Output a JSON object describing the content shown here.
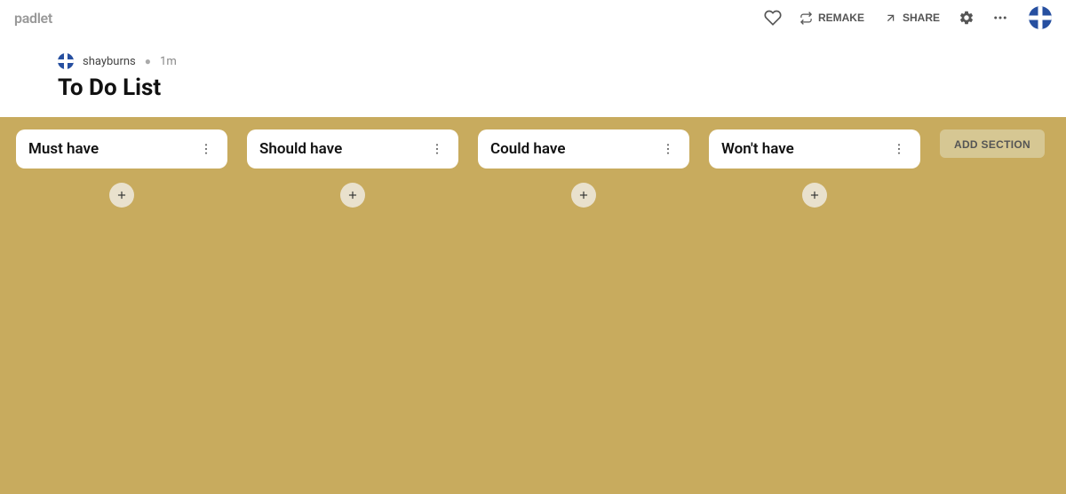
{
  "logo": "padlet",
  "header": {
    "remake_label": "REMAKE",
    "share_label": "SHARE"
  },
  "meta": {
    "username": "shayburns",
    "timestamp": "1m"
  },
  "board": {
    "title": "To Do List",
    "add_section_label": "ADD SECTION",
    "columns": [
      {
        "title": "Must have"
      },
      {
        "title": "Should have"
      },
      {
        "title": "Could have"
      },
      {
        "title": "Won't have"
      }
    ]
  }
}
